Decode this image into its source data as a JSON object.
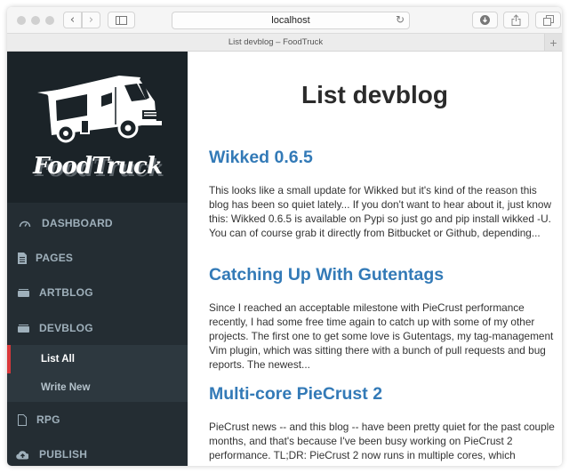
{
  "browser": {
    "address": "localhost",
    "tab_title": "List devblog – FoodTruck",
    "icons": {
      "back": "chevron-left-icon",
      "forward": "chevron-right-icon",
      "sidebar": "sidebar-icon",
      "reload": "reload-icon",
      "download": "download-icon",
      "share": "share-icon",
      "tabs": "tabs-icon",
      "new_tab": "plus-icon"
    },
    "glyphs": {
      "back": "‹",
      "forward": "›",
      "reload": "↻",
      "new_tab": "+"
    }
  },
  "sidebar": {
    "logo_text": "FoodTruck",
    "items": [
      {
        "label": "DASHBOARD",
        "icon": "dashboard-gauge-icon"
      },
      {
        "label": "PAGES",
        "icon": "file-text-icon"
      },
      {
        "label": "ARTBLOG",
        "icon": "folder-icon"
      },
      {
        "label": "DEVBLOG",
        "icon": "folder-icon"
      },
      {
        "label": "RPG",
        "icon": "file-outline-icon"
      },
      {
        "label": "PUBLISH",
        "icon": "cloud-upload-icon"
      }
    ],
    "devblog_submenu": [
      {
        "label": "List All",
        "active": true
      },
      {
        "label": "Write New",
        "active": false
      }
    ],
    "colors": {
      "background": "#242d33",
      "active_marker": "#d9383a"
    }
  },
  "main": {
    "title": "List devblog",
    "link_color": "#337ab7",
    "posts": [
      {
        "title": "Wikked 0.6.5",
        "excerpt": "This looks like a small update for Wikked but it's kind of the reason this blog has been so quiet lately... If you don't want to hear about it, just know this: Wikked 0.6.5 is available on Pypi so just go and pip install wikked -U. You can of course grab it directly from Bitbucket or Github, depending..."
      },
      {
        "title": "Catching Up With Gutentags",
        "excerpt": "Since I reached an acceptable milestone with PieCrust performance recently, I had some free time again to catch up with some of my other projects. The first one to get some love is Gutentags, my tag-management Vim plugin, which was sitting there with a bunch of pull requests and bug reports. The newest..."
      },
      {
        "title": "Multi-core PieCrust 2",
        "excerpt": "PieCrust news -- and this blog -- have been pretty quiet for the past couple months, and that's because I've been busy working on PieCrust 2 performance. TL;DR: PieCrust 2 now runs in multiple cores, which"
      }
    ]
  }
}
